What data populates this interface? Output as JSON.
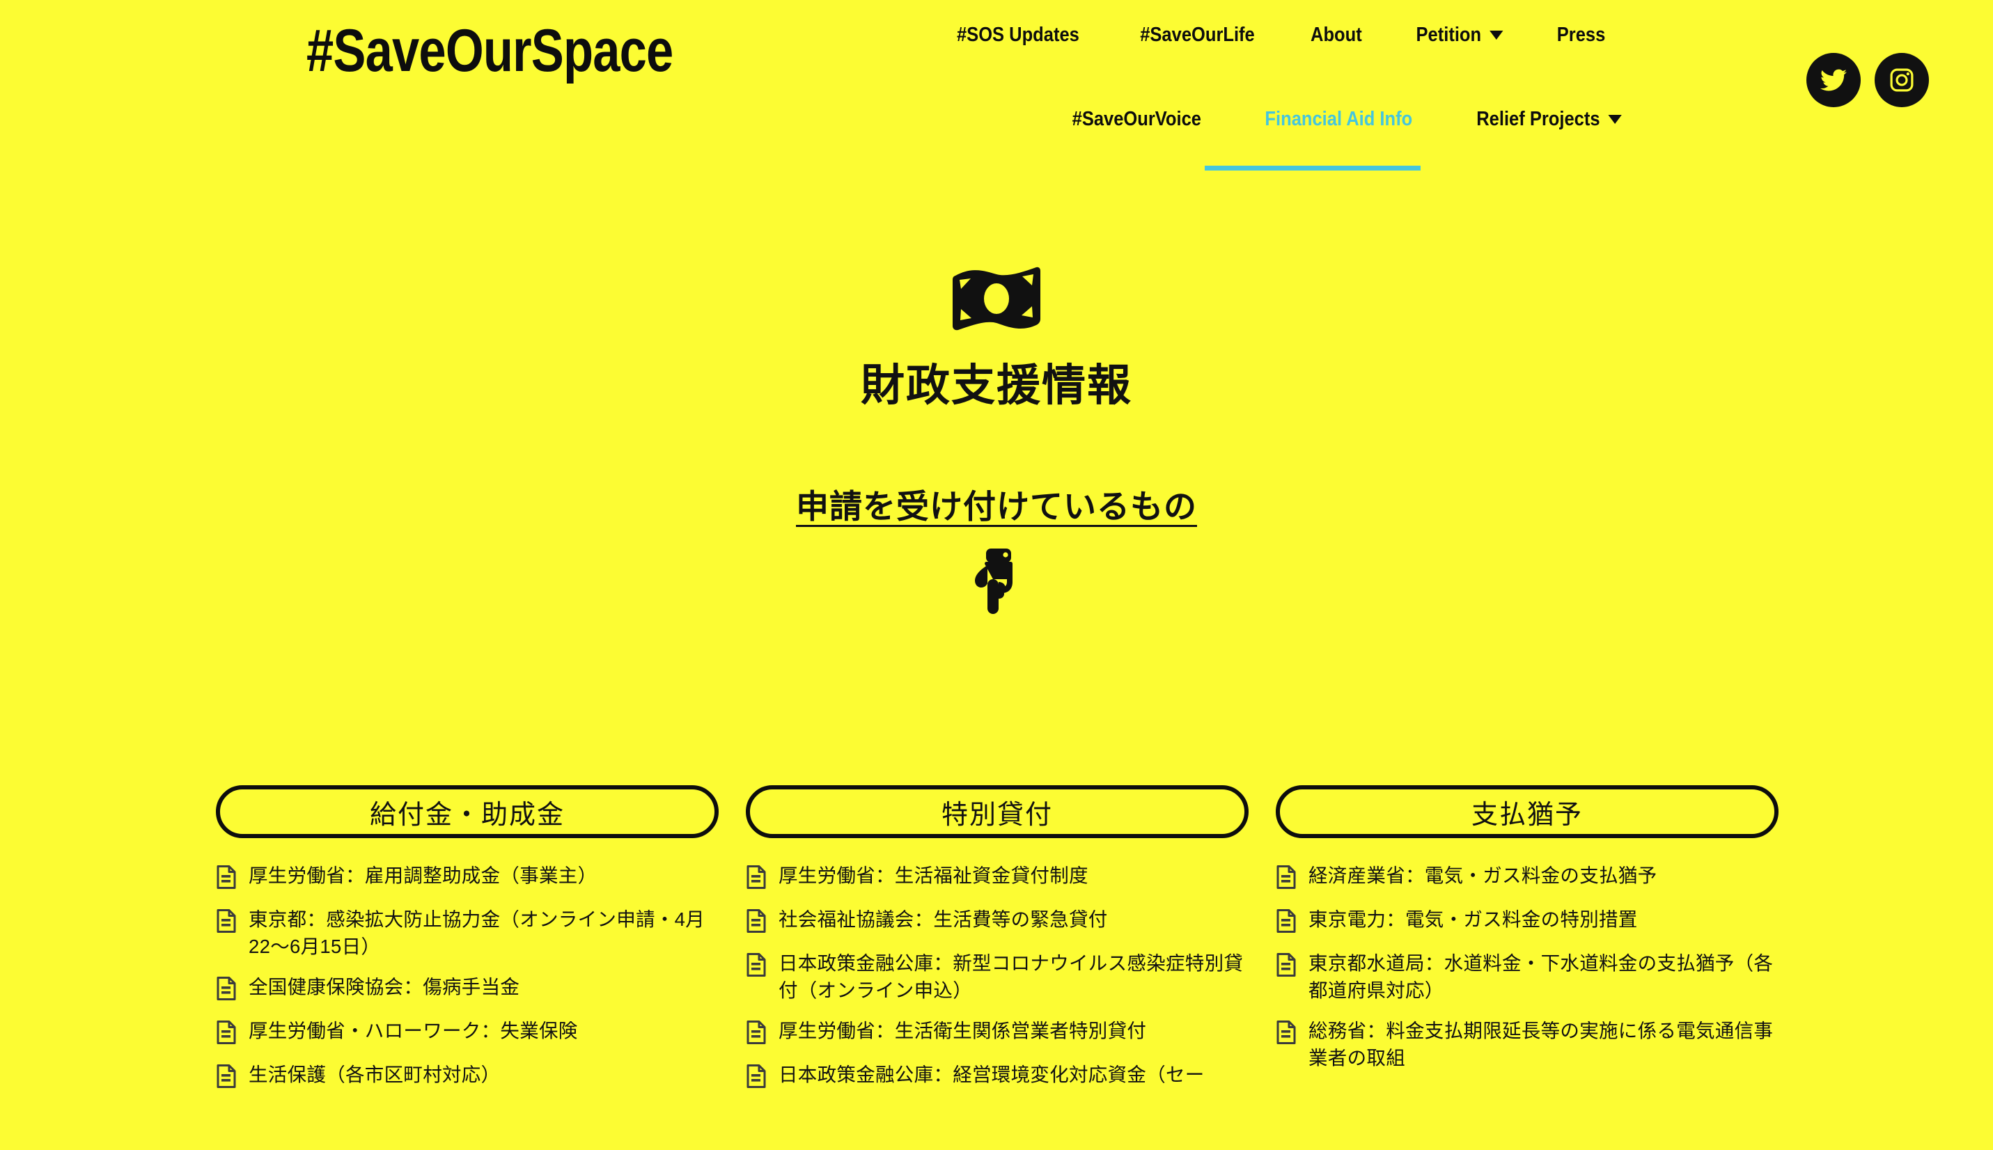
{
  "site": {
    "logo": "#SaveOurSpace",
    "background_color": "#FCFC33",
    "accent_color": "#45C6DE",
    "text_color": "#111111"
  },
  "nav": {
    "row1": [
      {
        "label": "#SOS Updates",
        "active": false,
        "has_caret": false
      },
      {
        "label": "#SaveOurLife",
        "active": false,
        "has_caret": false
      },
      {
        "label": "About",
        "active": false,
        "has_caret": false
      },
      {
        "label": "Petition",
        "active": false,
        "has_caret": true
      },
      {
        "label": "Press",
        "active": false,
        "has_caret": false
      }
    ],
    "row2": [
      {
        "label": "#SaveOurVoice",
        "active": false,
        "has_caret": false
      },
      {
        "label": "Financial Aid Info",
        "active": true,
        "has_caret": false
      },
      {
        "label": "Relief Projects",
        "active": false,
        "has_caret": true
      }
    ]
  },
  "socials": [
    {
      "name": "twitter",
      "label": "Twitter"
    },
    {
      "name": "instagram",
      "label": "Instagram"
    }
  ],
  "hero": {
    "icon": "money-bill-icon",
    "title": "財政支援情報",
    "subheading": "申請を受け付けているもの",
    "pointer_icon": "hand-point-down-icon"
  },
  "columns": [
    {
      "header": "給付金・助成金",
      "items": [
        "厚生労働省：雇用調整助成金（事業主）",
        "東京都：感染拡大防止協力金（オンライン申請・4月22〜6月15日）",
        "全国健康保険協会：傷病手当金",
        "厚生労働省・ハローワーク：失業保険",
        "生活保護（各市区町村対応）"
      ]
    },
    {
      "header": "特別貸付",
      "items": [
        "厚生労働省：生活福祉資金貸付制度",
        "社会福祉協議会：生活費等の緊急貸付",
        "日本政策金融公庫：新型コロナウイルス感染症特別貸付（オンライン申込）",
        "厚生労働省：生活衛生関係営業者特別貸付",
        "日本政策金融公庫：経営環境変化対応資金（セー"
      ]
    },
    {
      "header": "支払猶予",
      "items": [
        "経済産業省：電気・ガス料金の支払猶予",
        "東京電力：電気・ガス料金の特別措置",
        "東京都水道局：水道料金・下水道料金の支払猶予（各都道府県対応）",
        "総務省：料金支払期限延長等の実施に係る電気通信事業者の取組"
      ]
    }
  ]
}
